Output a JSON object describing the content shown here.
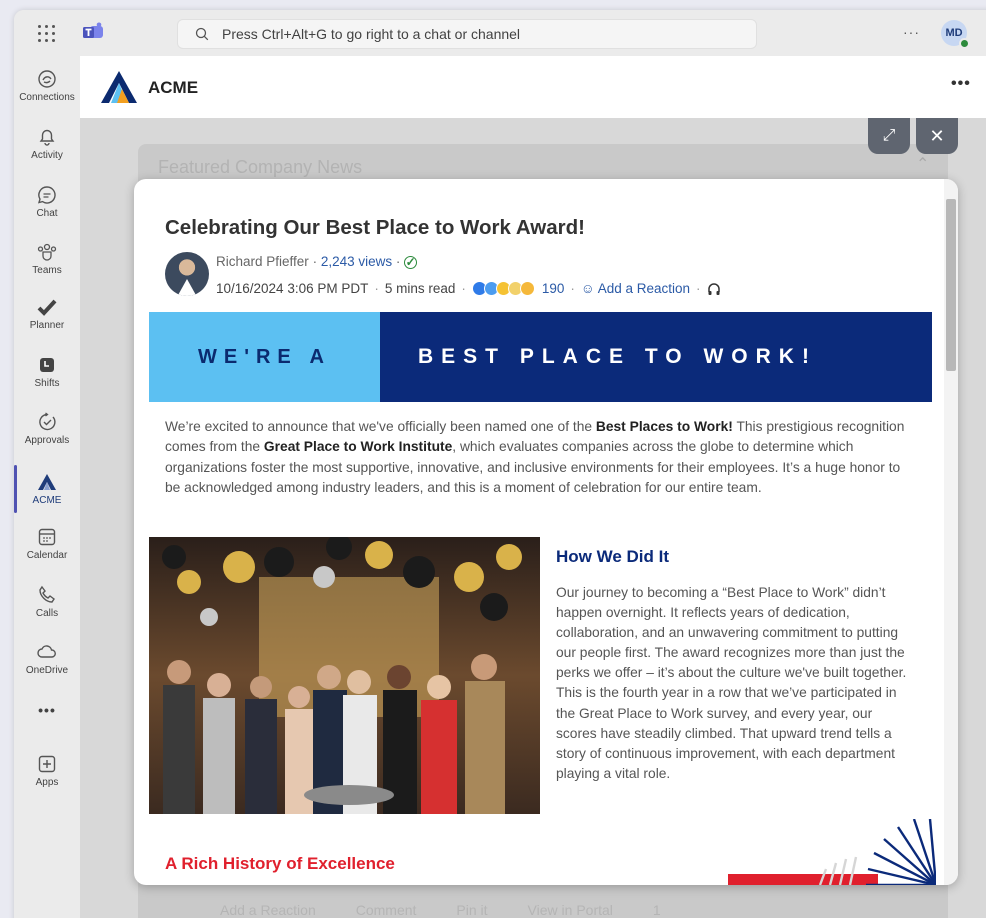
{
  "topbar": {
    "search_placeholder": "Press Ctrl+Alt+G to go right to a chat or channel",
    "more": "···",
    "avatar_initials": "MD"
  },
  "rail": {
    "items": [
      {
        "label": "Connections",
        "icon": "connections-icon"
      },
      {
        "label": "Activity",
        "icon": "bell-icon"
      },
      {
        "label": "Chat",
        "icon": "chat-icon"
      },
      {
        "label": "Teams",
        "icon": "teams-icon"
      },
      {
        "label": "Planner",
        "icon": "planner-icon"
      },
      {
        "label": "Shifts",
        "icon": "shifts-icon"
      },
      {
        "label": "Approvals",
        "icon": "approvals-icon"
      },
      {
        "label": "ACME",
        "icon": "acme-icon"
      },
      {
        "label": "Calendar",
        "icon": "calendar-icon"
      },
      {
        "label": "Calls",
        "icon": "phone-icon"
      },
      {
        "label": "OneDrive",
        "icon": "cloud-icon"
      },
      {
        "label": "",
        "icon": "more-icon"
      },
      {
        "label": "Apps",
        "icon": "add-app-icon"
      }
    ]
  },
  "app": {
    "title": "ACME",
    "more": "•••"
  },
  "background": {
    "section_title": "Featured Company News",
    "footer": [
      "Add a Reaction",
      "Comment",
      "Pin it",
      "View in Portal",
      "1"
    ]
  },
  "article": {
    "title": "Celebrating Our Best Place to Work Award!",
    "author": "Richard Pfieffer",
    "views": "2,243 views",
    "date": "10/16/2024 3:06 PM PDT",
    "read_time": "5 mins read",
    "reaction_count": "190",
    "add_reaction": "Add a Reaction",
    "banner_left": "WE'RE A",
    "banner_right": "BEST PLACE TO WORK!",
    "intro": {
      "t1": "We’re excited to announce that we've officially been named one of the ",
      "b1": "Best Places to Work!",
      "t2": " This prestigious recognition comes from the ",
      "b2": "Great Place to Work Institute",
      "t3": ", which evaluates companies across the globe to determine which organizations foster the most supportive, innovative, and inclusive environments for their employees. It’s a huge honor to be acknowledged among industry leaders, and this is a moment of celebration for our entire team."
    },
    "section1_heading": "How We Did It",
    "section1_body": "Our journey to becoming a “Best Place to Work” didn’t happen overnight. It reflects years of dedication, collaboration, and an unwavering commitment to putting our people first. The award recognizes more than just the perks we offer – it’s about the culture we've built together. This is the fourth year in a row that we’ve participated in the Great Place to Work survey, and every year, our scores have steadily climbed. That upward trend tells a story of continuous improvement, with each department playing a vital role.",
    "section2_heading": "A Rich History of Excellence"
  },
  "colors": {
    "brand_navy": "#0b2a7a",
    "banner_light": "#5cc0f2",
    "accent_red": "#e0202d",
    "link_blue": "#2b5aa6"
  }
}
